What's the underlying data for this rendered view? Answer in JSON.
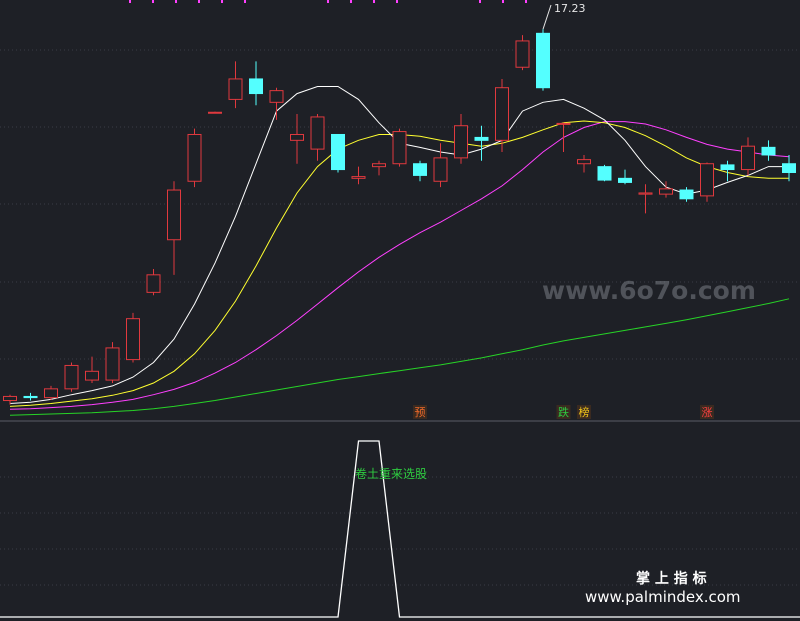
{
  "main_panel": {
    "peak_label": "17.23",
    "markers": [
      {
        "text": "预",
        "color": "#f06a2a"
      },
      {
        "text": "跌",
        "color": "#2ecc40"
      },
      {
        "text": "榜",
        "color": "#f0c419"
      },
      {
        "text": "涨",
        "color": "#ff4040"
      }
    ]
  },
  "indicator_panel": {
    "signal_label": "卷土重来选股"
  },
  "watermarks": {
    "site_top": "www.6o7o.com",
    "brand_title": "掌 上 指 标",
    "site_bottom": "www.palmindex.com"
  },
  "colors": {
    "background": "#1e2026",
    "grid": "#3a3d46",
    "up_candle": "#e0393e",
    "down_candle": "#54ffff",
    "ma5": "#ffffff",
    "ma10": "#ffff30",
    "ma20": "#ff40ff",
    "ma60": "#27d327",
    "indicator_line": "#ffffff",
    "signal_text": "#2ecc40"
  },
  "chart_data": [
    {
      "type": "candlestick",
      "candles": [
        {
          "o": 10.95,
          "h": 11.05,
          "l": 10.88,
          "c": 11.02
        },
        {
          "o": 11.02,
          "h": 11.08,
          "l": 10.95,
          "c": 11.0
        },
        {
          "o": 11.0,
          "h": 11.2,
          "l": 10.96,
          "c": 11.15
        },
        {
          "o": 11.15,
          "h": 11.6,
          "l": 11.1,
          "c": 11.55
        },
        {
          "o": 11.3,
          "h": 11.7,
          "l": 11.25,
          "c": 11.45
        },
        {
          "o": 11.3,
          "h": 11.95,
          "l": 11.25,
          "c": 11.85
        },
        {
          "o": 11.65,
          "h": 12.45,
          "l": 11.6,
          "c": 12.35
        },
        {
          "o": 12.8,
          "h": 13.2,
          "l": 12.75,
          "c": 13.1
        },
        {
          "o": 13.7,
          "h": 14.7,
          "l": 13.1,
          "c": 14.55
        },
        {
          "o": 14.7,
          "h": 15.6,
          "l": 14.6,
          "c": 15.5
        },
        {
          "o": 15.88,
          "h": 15.89,
          "l": 15.87,
          "c": 15.88
        },
        {
          "o": 16.1,
          "h": 16.75,
          "l": 15.95,
          "c": 16.45
        },
        {
          "o": 16.45,
          "h": 16.75,
          "l": 16.0,
          "c": 16.2
        },
        {
          "o": 16.05,
          "h": 16.3,
          "l": 15.75,
          "c": 16.25
        },
        {
          "o": 15.4,
          "h": 15.85,
          "l": 15.0,
          "c": 15.5
        },
        {
          "o": 15.25,
          "h": 15.85,
          "l": 15.05,
          "c": 15.8
        },
        {
          "o": 15.5,
          "h": 15.5,
          "l": 14.85,
          "c": 14.9
        },
        {
          "o": 14.75,
          "h": 14.95,
          "l": 14.65,
          "c": 14.78
        },
        {
          "o": 14.95,
          "h": 15.05,
          "l": 14.8,
          "c": 15.0
        },
        {
          "o": 15.0,
          "h": 15.6,
          "l": 14.95,
          "c": 15.55
        },
        {
          "o": 15.0,
          "h": 15.05,
          "l": 14.7,
          "c": 14.8
        },
        {
          "o": 14.7,
          "h": 15.35,
          "l": 14.6,
          "c": 15.1
        },
        {
          "o": 15.1,
          "h": 15.85,
          "l": 15.0,
          "c": 15.65
        },
        {
          "o": 15.45,
          "h": 15.65,
          "l": 15.05,
          "c": 15.4
        },
        {
          "o": 15.4,
          "h": 16.45,
          "l": 15.2,
          "c": 16.3
        },
        {
          "o": 16.65,
          "h": 17.2,
          "l": 16.6,
          "c": 17.1
        },
        {
          "o": 17.23,
          "h": 17.3,
          "l": 16.25,
          "c": 16.3
        },
        {
          "o": 15.68,
          "h": 15.7,
          "l": 15.2,
          "c": 15.69
        },
        {
          "o": 15.0,
          "h": 15.15,
          "l": 14.85,
          "c": 15.07
        },
        {
          "o": 14.95,
          "h": 14.98,
          "l": 14.7,
          "c": 14.72
        },
        {
          "o": 14.75,
          "h": 14.9,
          "l": 14.65,
          "c": 14.68
        },
        {
          "o": 14.48,
          "h": 14.65,
          "l": 14.15,
          "c": 14.5
        },
        {
          "o": 14.48,
          "h": 14.7,
          "l": 14.42,
          "c": 14.57
        },
        {
          "o": 14.55,
          "h": 14.6,
          "l": 14.35,
          "c": 14.4
        },
        {
          "o": 14.45,
          "h": 15.02,
          "l": 14.35,
          "c": 15.0
        },
        {
          "o": 14.98,
          "h": 15.05,
          "l": 14.7,
          "c": 14.9
        },
        {
          "o": 14.9,
          "h": 15.45,
          "l": 14.8,
          "c": 15.3
        },
        {
          "o": 15.28,
          "h": 15.4,
          "l": 15.05,
          "c": 15.15
        },
        {
          "o": 15.0,
          "h": 15.15,
          "l": 14.7,
          "c": 14.85
        }
      ],
      "ma5": [
        10.9,
        10.92,
        10.97,
        11.05,
        11.12,
        11.2,
        11.35,
        11.6,
        12.0,
        12.6,
        13.3,
        14.1,
        15.0,
        15.9,
        16.2,
        16.32,
        16.32,
        16.1,
        15.7,
        15.35,
        15.28,
        15.2,
        15.15,
        15.25,
        15.4,
        15.9,
        16.05,
        16.1,
        15.95,
        15.75,
        15.4,
        14.95,
        14.6,
        14.48,
        14.55,
        14.68,
        14.8,
        14.95,
        14.95
      ],
      "ma10": [
        10.85,
        10.87,
        10.9,
        10.94,
        10.98,
        11.04,
        11.12,
        11.25,
        11.45,
        11.75,
        12.15,
        12.65,
        13.25,
        13.9,
        14.5,
        14.95,
        15.25,
        15.4,
        15.5,
        15.5,
        15.47,
        15.4,
        15.35,
        15.3,
        15.35,
        15.45,
        15.58,
        15.7,
        15.73,
        15.7,
        15.62,
        15.48,
        15.3,
        15.1,
        14.95,
        14.85,
        14.78,
        14.75,
        14.75
      ],
      "ma20": [
        10.8,
        10.81,
        10.83,
        10.85,
        10.88,
        10.92,
        10.97,
        11.05,
        11.14,
        11.26,
        11.42,
        11.6,
        11.82,
        12.06,
        12.32,
        12.6,
        12.88,
        13.15,
        13.4,
        13.62,
        13.82,
        14.0,
        14.2,
        14.4,
        14.62,
        14.9,
        15.2,
        15.45,
        15.62,
        15.72,
        15.72,
        15.68,
        15.58,
        15.45,
        15.33,
        15.25,
        15.2,
        15.15,
        15.12
      ],
      "ma60": [
        10.7,
        10.71,
        10.72,
        10.73,
        10.74,
        10.76,
        10.78,
        10.81,
        10.85,
        10.9,
        10.95,
        11.01,
        11.07,
        11.13,
        11.19,
        11.25,
        11.31,
        11.36,
        11.41,
        11.46,
        11.51,
        11.56,
        11.62,
        11.68,
        11.75,
        11.82,
        11.9,
        11.97,
        12.03,
        12.09,
        12.15,
        12.21,
        12.27,
        12.33,
        12.4,
        12.47,
        12.54,
        12.61,
        12.69
      ],
      "ylim": [
        10.6,
        17.8
      ],
      "markers": [
        {
          "index": 20,
          "text": "预"
        },
        {
          "index": 27,
          "text": "跌"
        },
        {
          "index": 28,
          "text": "榜"
        },
        {
          "index": 34,
          "text": "涨"
        }
      ]
    },
    {
      "type": "line",
      "name": "卷土重来选股",
      "values": [
        0,
        0,
        0,
        0,
        0,
        0,
        0,
        0,
        0,
        0,
        0,
        0,
        0,
        0,
        0,
        0,
        0,
        1,
        1,
        0,
        0,
        0,
        0,
        0,
        0,
        0,
        0,
        0,
        0,
        0,
        0,
        0,
        0,
        0,
        0,
        0,
        0,
        0,
        0
      ],
      "ylim": [
        0,
        1
      ]
    }
  ]
}
